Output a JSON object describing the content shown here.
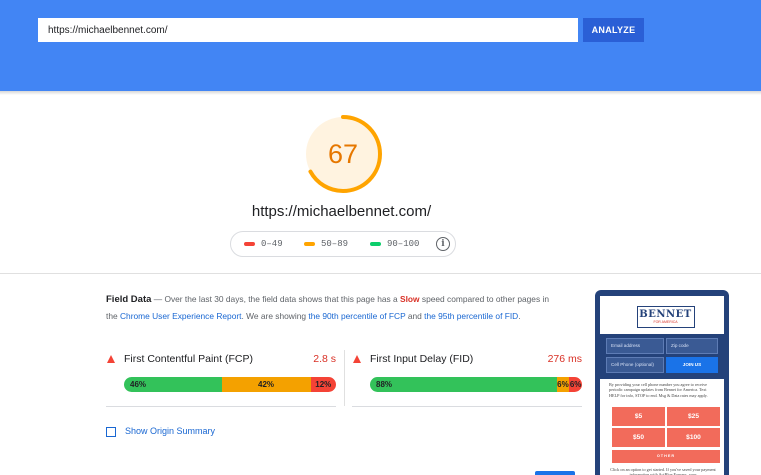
{
  "header": {
    "url_value": "https://michaelbennet.com/",
    "analyze_label": "ANALYZE",
    "background_color": "#4285f4"
  },
  "score": {
    "value": 67,
    "display": "67",
    "color": "#ffa400",
    "page_url": "https://michaelbennet.com/"
  },
  "legend": {
    "items": [
      {
        "label": "0–49",
        "color": "#f44336"
      },
      {
        "label": "50–89",
        "color": "#ffa400"
      },
      {
        "label": "90–100",
        "color": "#0cce6b"
      }
    ],
    "info_icon": "info-icon"
  },
  "field_data": {
    "title": "Field Data",
    "dash": " — ",
    "text_1": "Over the last 30 days, the field data shows that this page has a ",
    "slow": "Slow",
    "text_2": " speed compared to other pages in the ",
    "link_crux": "Chrome User Experience Report",
    "text_3": ". We are showing ",
    "link_fcp": "the 90th percentile of FCP",
    "text_4": " and ",
    "link_fid": "the 95th percentile of FID",
    "text_5": "."
  },
  "metrics": [
    {
      "name": "First Contentful Paint (FCP)",
      "value": "2.8 s",
      "distribution": {
        "fast": 46,
        "average": 42,
        "slow": 12
      },
      "labels": {
        "fast": "46%",
        "average": "42%",
        "slow": "12%"
      }
    },
    {
      "name": "First Input Delay (FID)",
      "value": "276 ms",
      "distribution": {
        "fast": 88,
        "average": 6,
        "slow": 6
      },
      "labels": {
        "fast": "88%",
        "average": "6%",
        "slow": "6%"
      }
    }
  ],
  "origin_summary": {
    "label": "Show Origin Summary",
    "checked": false
  },
  "thumbnail": {
    "brand": "BENNET",
    "brand_sub": "FOR AMERICA",
    "email_placeholder": "Email address",
    "zip_placeholder": "Zip code",
    "phone_placeholder": "Cell Phone (optional)",
    "join_label": "JOIN US",
    "fine_print": "By providing your cell phone number you agree to receive periodic campaign updates from Bennet for America. Text HELP for info, STOP to end. Msg & Data rates may apply.",
    "amounts": [
      "$5",
      "$25",
      "$50",
      "$100"
    ],
    "other_label": "OTHER",
    "fine_print_2": "Click on an option to get started. If you've saved your payment information with ActBlue Express, your"
  }
}
